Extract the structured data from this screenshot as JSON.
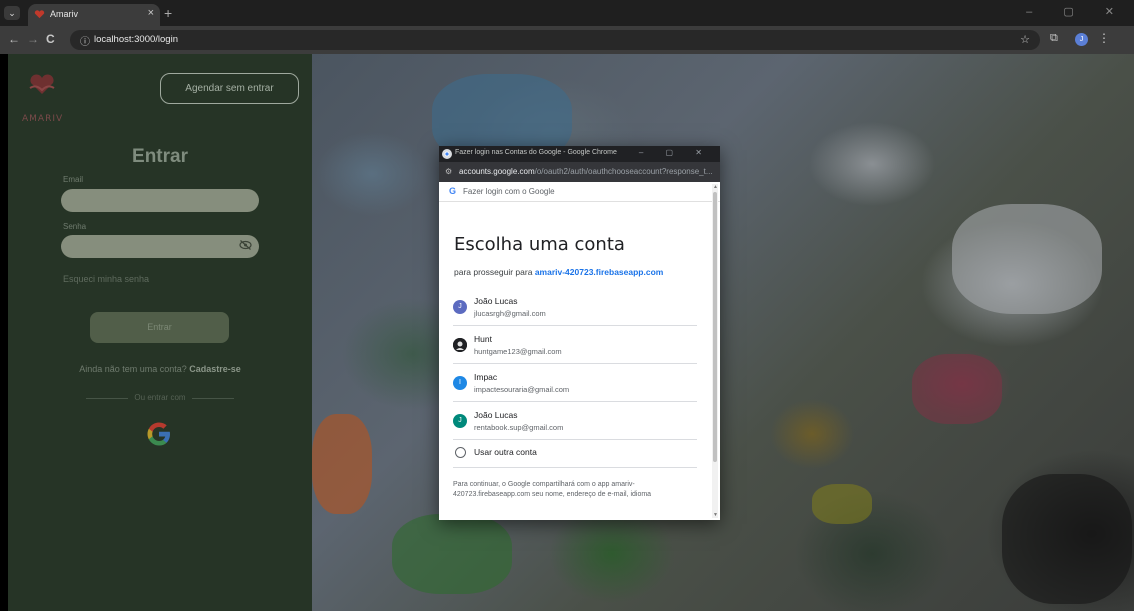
{
  "browser": {
    "tab_title": "Amariv",
    "tab_close": "×",
    "new_tab": "+",
    "window_controls": "– ▢ ✕",
    "back": "←",
    "forward": "→",
    "reload": "C",
    "url": "localhost:3000/login",
    "profile_initial": "J"
  },
  "app": {
    "logo_text": "AMARIV",
    "schedule_button": "Agendar sem entrar",
    "login_title": "Entrar",
    "email_label": "Email",
    "password_label": "Senha",
    "forgot_password": "Esqueci minha senha",
    "submit_button": "Entrar",
    "signup_prompt": "Ainda não tem uma conta?",
    "signup_link": "Cadastre-se",
    "or_divider": "Ou entrar com"
  },
  "popup": {
    "window_title": "Fazer login nas Contas do Google - Google Chrome",
    "url_host": "accounts.google.com",
    "url_path": "/o/oauth2/auth/oauthchooseaccount?response_t...",
    "header_text": "Fazer login com o Google",
    "choose_title": "Escolha uma conta",
    "continue_prefix": "para prosseguir para",
    "continue_app": "amariv-420723.firebaseapp.com",
    "accounts": [
      {
        "name": "João Lucas",
        "email": "jlucasrgh@gmail.com",
        "initial": "J",
        "color": "#5c6bc0"
      },
      {
        "name": "Hunt",
        "email": "huntgame123@gmail.com",
        "initial": "",
        "color": "#202124"
      },
      {
        "name": "Impac",
        "email": "impactesouraria@gmail.com",
        "initial": "I",
        "color": "#1e88e5"
      },
      {
        "name": "João Lucas",
        "email": "rentabook.sup@gmail.com",
        "initial": "J",
        "color": "#00897b"
      }
    ],
    "other_account": "Usar outra conta",
    "footer": "Para continuar, o Google compartilhará com o app amariv-420723.firebaseapp.com seu nome, endereço de e-mail, idioma"
  }
}
